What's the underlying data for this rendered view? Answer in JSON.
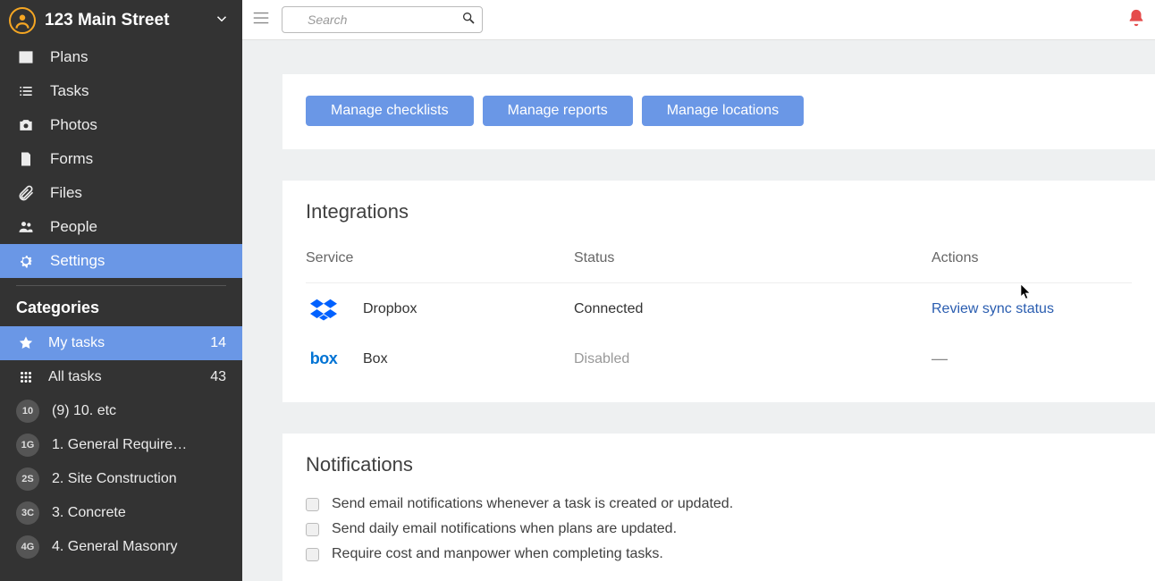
{
  "project_title": "123 Main Street",
  "search_placeholder": "Search",
  "nav": [
    {
      "label": "Plans"
    },
    {
      "label": "Tasks"
    },
    {
      "label": "Photos"
    },
    {
      "label": "Forms"
    },
    {
      "label": "Files"
    },
    {
      "label": "People"
    },
    {
      "label": "Settings"
    }
  ],
  "categories_title": "Categories",
  "categories": [
    {
      "badge_type": "star",
      "label": "My tasks",
      "count": "14",
      "active": true
    },
    {
      "badge_type": "grid",
      "label": "All tasks",
      "count": "43"
    },
    {
      "badge": "10",
      "label": "(9) 10. etc"
    },
    {
      "badge": "1G",
      "label": "1. General Requireme…"
    },
    {
      "badge": "2S",
      "label": "2. Site Construction"
    },
    {
      "badge": "3C",
      "label": "3. Concrete"
    },
    {
      "badge": "4G",
      "label": "4. General Masonry"
    }
  ],
  "manage_buttons": {
    "checklists": "Manage checklists",
    "reports": "Manage reports",
    "locations": "Manage locations"
  },
  "integrations": {
    "title": "Integrations",
    "head": {
      "service": "Service",
      "status": "Status",
      "actions": "Actions"
    },
    "rows": [
      {
        "service": "Dropbox",
        "status": "Connected",
        "action": "Review sync status",
        "disabled": false
      },
      {
        "service": "Box",
        "status": "Disabled",
        "action": "—",
        "disabled": true
      }
    ]
  },
  "notifications": {
    "title": "Notifications",
    "items": [
      "Send email notifications whenever a task is created or updated.",
      "Send daily email notifications when plans are updated.",
      "Require cost and manpower when completing tasks."
    ]
  }
}
